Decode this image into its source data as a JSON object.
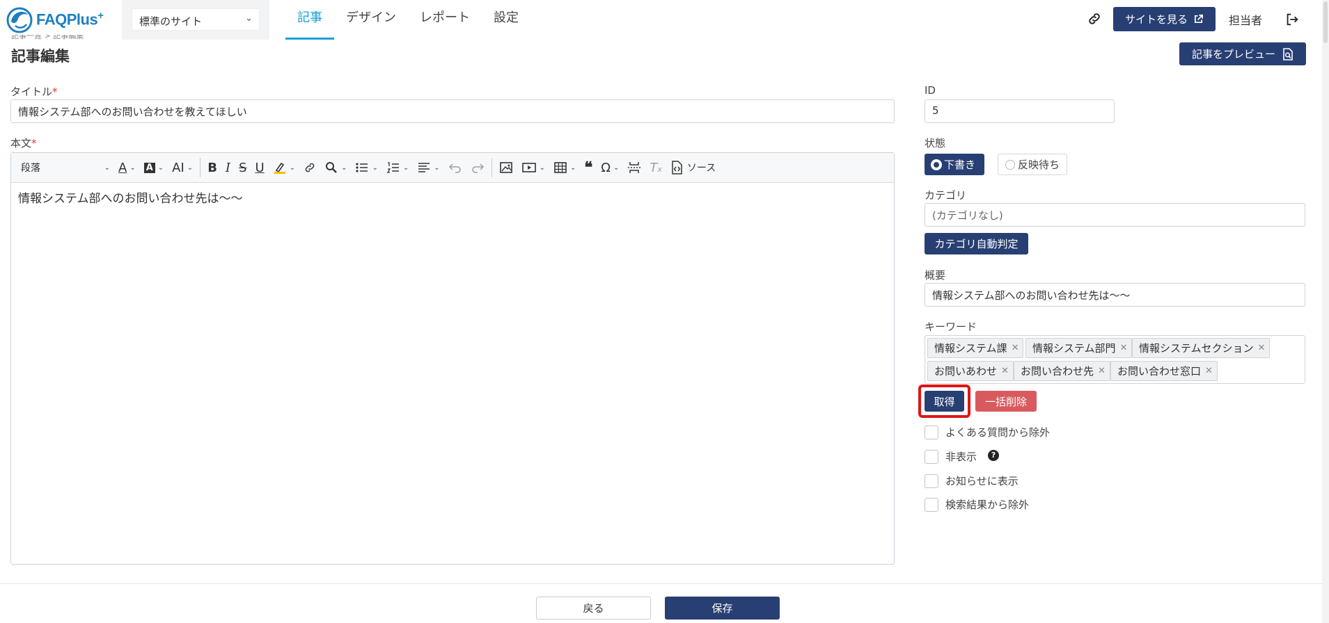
{
  "header": {
    "logo_text": "FAQPlus",
    "logo_sup": "+",
    "site_select": "標準のサイト",
    "nav": [
      "記事",
      "デザイン",
      "レポート",
      "設定"
    ],
    "view_site": "サイトを見る",
    "user": "担当者"
  },
  "page": {
    "breadcrumb": "記事一覧 > 記事編集",
    "title": "記事編集",
    "preview": "記事をプレビュー"
  },
  "form": {
    "title_label": "タイトル",
    "required_mark": "*",
    "title_value": "情報システム部へのお問い合わせを教えてほしい",
    "body_label": "本文",
    "paragraph": "段落",
    "source": "ソース",
    "body_text": "情報システム部へのお問い合わせ先は〜〜",
    "id_label": "ID",
    "id_value": "5",
    "state_label": "状態",
    "state_draft": "下書き",
    "state_pending": "反映待ち",
    "category_label": "カテゴリ",
    "category_placeholder": "(カテゴリなし)",
    "auto_category": "カテゴリ自動判定",
    "summary_label": "概要",
    "summary_value": "情報システム部へのお問い合わせ先は〜〜",
    "keyword_label": "キーワード",
    "keywords": [
      "情報システム課",
      "情報システム部門",
      "情報システムセクション",
      "お問いあわせ",
      "お問い合わせ先",
      "お問い合わせ窓口"
    ],
    "fetch": "取得",
    "clear_all": "一括削除",
    "checkboxes": [
      "よくある質問から除外",
      "非表示",
      "お知らせに表示",
      "検索結果から除外"
    ],
    "help_mark": "?"
  },
  "footer": {
    "back": "戻る",
    "save": "保存"
  },
  "colors": {
    "primary": "#283f73",
    "accent": "#1aa0d8",
    "danger": "#d85a5e",
    "highlight": "#e01515"
  }
}
